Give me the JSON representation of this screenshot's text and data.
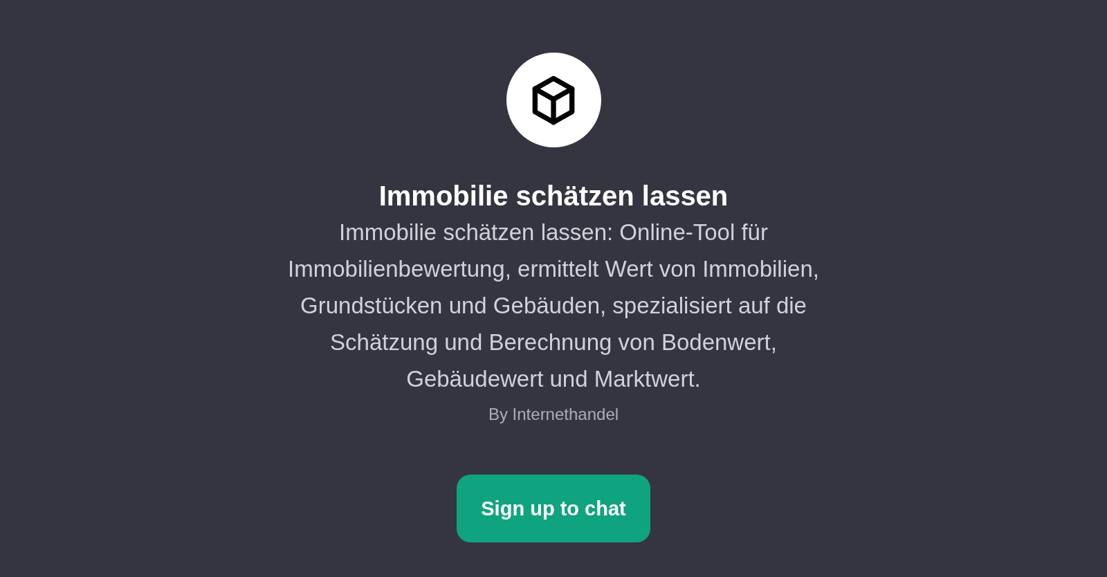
{
  "title": "Immobilie schätzen lassen",
  "description": "Immobilie schätzen lassen: Online-Tool für Immobilienbewertung, ermittelt Wert von Immobilien, Grundstücken und Gebäuden, spezialisiert auf die Schätzung und Berechnung von Bodenwert, Gebäudewert und Marktwert.",
  "author": "By Internethandel",
  "button": "Sign up to chat"
}
